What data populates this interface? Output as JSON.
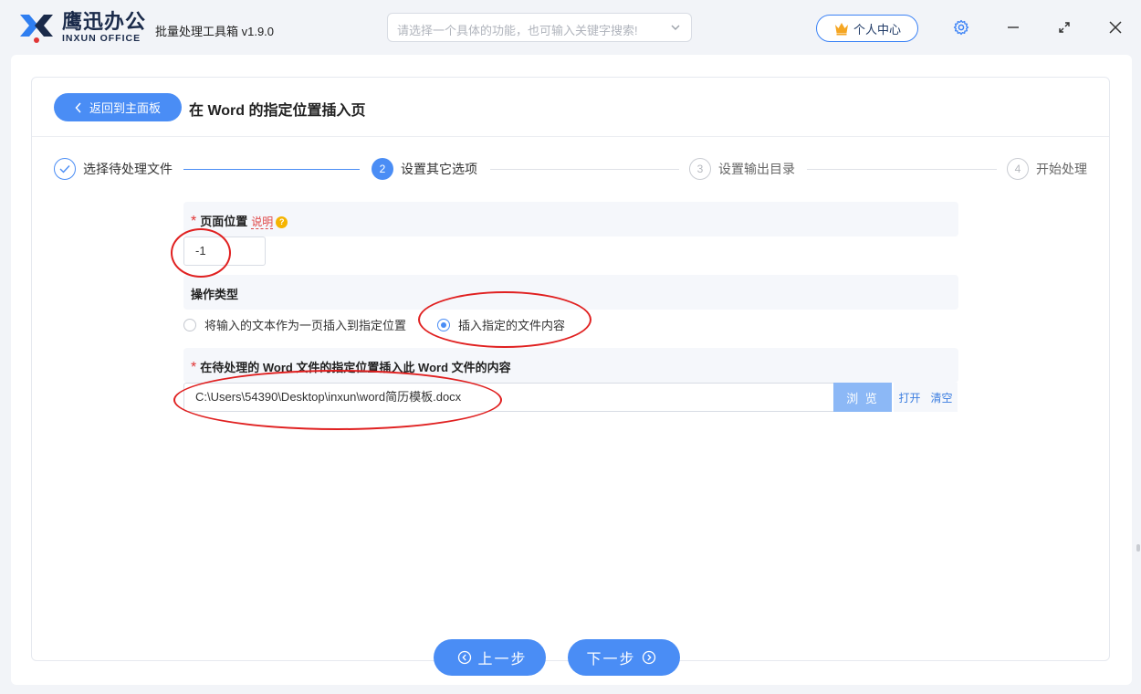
{
  "app": {
    "logo_cn": "鹰迅办公",
    "logo_en": "INXUN OFFICE",
    "name": "批量处理工具箱 v1.9.0"
  },
  "search": {
    "placeholder": "请选择一个具体的功能，也可输入关键字搜索!"
  },
  "header": {
    "user_center": "个人中心"
  },
  "page": {
    "back_label": "返回到主面板",
    "title": "在 Word 的指定位置插入页"
  },
  "steps": [
    {
      "num": "✓",
      "label": "选择待处理文件",
      "state": "done"
    },
    {
      "num": "2",
      "label": "设置其它选项",
      "state": "active"
    },
    {
      "num": "3",
      "label": "设置输出目录",
      "state": "todo"
    },
    {
      "num": "4",
      "label": "开始处理",
      "state": "todo"
    }
  ],
  "form": {
    "page_position": {
      "required_mark": "*",
      "label": "页面位置",
      "hint": "说明",
      "hint_icon": "?",
      "value": "-1"
    },
    "operation_type": {
      "label": "操作类型",
      "options": [
        {
          "label": "将输入的文本作为一页插入到指定位置",
          "selected": false
        },
        {
          "label": "插入指定的文件内容",
          "selected": true
        }
      ]
    },
    "insert_file": {
      "required_mark": "*",
      "label": "在待处理的 Word 文件的指定位置插入此 Word 文件的内容",
      "value": "C:\\Users\\54390\\Desktop\\inxun\\word简历模板.docx",
      "browse": "浏 览",
      "open": "打开",
      "clear": "清空"
    }
  },
  "footer": {
    "prev": "上一步",
    "next": "下一步"
  },
  "colors": {
    "accent": "#4a8df5",
    "annotation": "#e02020",
    "required": "#e03535"
  }
}
